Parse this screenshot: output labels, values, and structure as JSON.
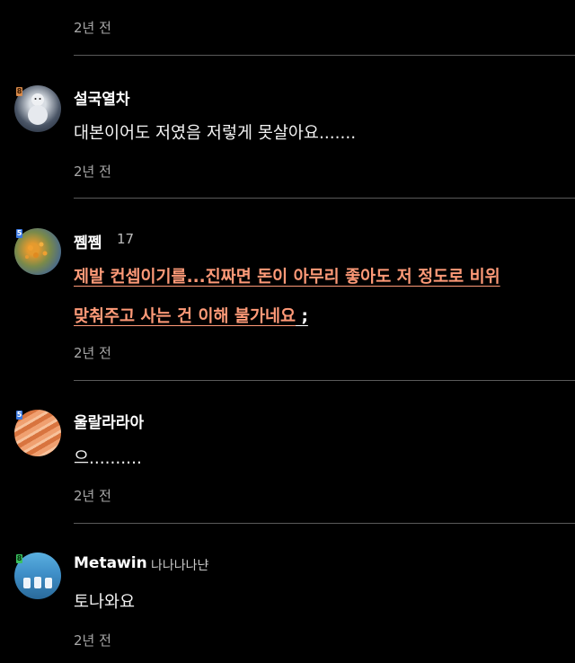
{
  "comments": [
    {
      "time": "2년 전"
    },
    {
      "username": "설국열차",
      "text": "대본이어도 저였음 저렇게 못살아요.......",
      "time": "2년 전",
      "badge": "8",
      "badge_color": "#d98a4a"
    },
    {
      "username": "쩸쩸",
      "meta": "17",
      "text_line1": "제발 컨셉이기를...진짜면 돈이 아무리 좋아도 저 정도로 비위",
      "text_line2_main": "맞춰주고 사는 건 이해 불가네요",
      "text_line2_tail": " ;",
      "time": "2년 전",
      "badge": "5",
      "badge_color": "#3a78e0",
      "highlight_color": "#ff9a78"
    },
    {
      "username": "울랄라라아",
      "text": "으..........",
      "time": "2년 전",
      "badge": "5",
      "badge_color": "#3a78e0"
    },
    {
      "username": "Metawin",
      "meta": "나나나나냔",
      "text": "토나와요",
      "time": "2년 전",
      "badge": "8",
      "badge_color": "#3ac060"
    }
  ]
}
